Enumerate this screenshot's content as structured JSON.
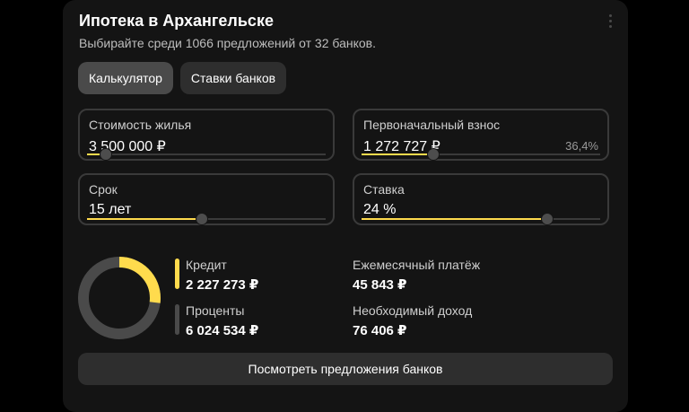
{
  "header": {
    "title": "Ипотека в Архангельске",
    "subtitle": "Выбирайте среди 1066 предложений от 32 банков."
  },
  "tabs": [
    {
      "label": "Калькулятор",
      "active": true
    },
    {
      "label": "Ставки банков",
      "active": false
    }
  ],
  "fields": {
    "cost": {
      "label": "Стоимость жилья",
      "value": "3 500 000 ₽",
      "slider_fraction": 0.08
    },
    "down_payment": {
      "label": "Первоначальный взнос",
      "value": "1 272 727 ₽",
      "extra": "36,4%",
      "slider_fraction": 0.3
    },
    "term": {
      "label": "Срок",
      "value": "15 лет",
      "slider_fraction": 0.48
    },
    "rate": {
      "label": "Ставка",
      "value": "24 %",
      "slider_fraction": 0.78
    }
  },
  "breakdown": {
    "credit": {
      "label": "Кредит",
      "value": "2 227 273 ₽",
      "amount": 2227273,
      "color": "#ffdb4d"
    },
    "interest": {
      "label": "Проценты",
      "value": "6 024 534 ₽",
      "amount": 6024534,
      "color": "#4a4a4a"
    }
  },
  "summary": {
    "monthly": {
      "label": "Ежемесячный платёж",
      "value": "45 843 ₽"
    },
    "income": {
      "label": "Необходимый доход",
      "value": "76 406 ₽"
    }
  },
  "cta": {
    "label": "Посмотреть предложения банков"
  },
  "colors": {
    "accent": "#ffdb4d",
    "card": "#141414",
    "muted": "#4a4a4a"
  }
}
